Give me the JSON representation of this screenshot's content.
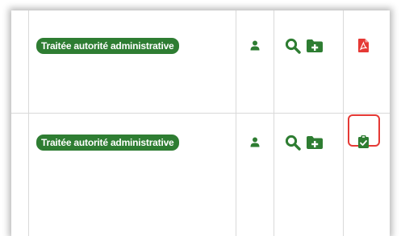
{
  "rows": [
    {
      "status_label": "Traitée autorité administrative",
      "icons": [
        "user-icon",
        "search-icon",
        "folder-plus-icon",
        "pdf-file-icon"
      ]
    },
    {
      "status_label": "Traitée autorité administrative",
      "icons": [
        "user-icon",
        "search-icon",
        "folder-plus-icon",
        "clipboard-check-icon"
      ],
      "highlighted_icon": "clipboard-check-icon"
    }
  ],
  "colors": {
    "status_green": "#2e7d32",
    "icon_green": "#2e7d32",
    "pdf_red": "#e53935",
    "highlight_red": "#e53935",
    "grid": "#d9d9d9"
  }
}
